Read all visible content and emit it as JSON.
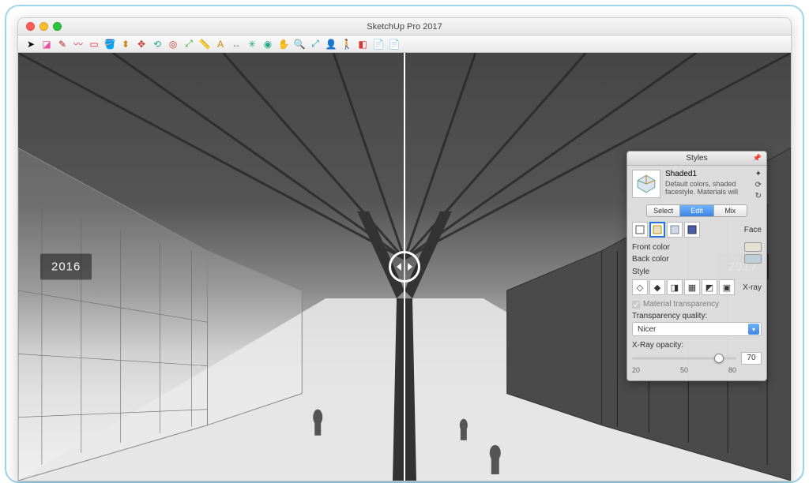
{
  "window": {
    "title": "SketchUp Pro 2017"
  },
  "toolbar": {
    "tools": [
      {
        "name": "select",
        "glyph": "➤",
        "color": "#000"
      },
      {
        "name": "eraser",
        "glyph": "◪",
        "color": "#e84fa0"
      },
      {
        "name": "line",
        "glyph": "✎",
        "color": "#b22"
      },
      {
        "name": "freehand",
        "glyph": "〰",
        "color": "#d33"
      },
      {
        "name": "rectangle",
        "glyph": "▭",
        "color": "#d33"
      },
      {
        "name": "paint",
        "glyph": "🪣",
        "color": "#c8860d"
      },
      {
        "name": "pushpull",
        "glyph": "⬍",
        "color": "#c8860d"
      },
      {
        "name": "move",
        "glyph": "✥",
        "color": "#c33"
      },
      {
        "name": "rotate",
        "glyph": "⟲",
        "color": "#2a8"
      },
      {
        "name": "offset",
        "glyph": "◎",
        "color": "#c33"
      },
      {
        "name": "scale",
        "glyph": "⤢",
        "color": "#3a3"
      },
      {
        "name": "tape",
        "glyph": "📏",
        "color": "#c8860d"
      },
      {
        "name": "text",
        "glyph": "A",
        "color": "#c8860d"
      },
      {
        "name": "dimension",
        "glyph": "↔",
        "color": "#888"
      },
      {
        "name": "axes",
        "glyph": "✳",
        "color": "#2a8"
      },
      {
        "name": "orbit",
        "glyph": "◉",
        "color": "#2a8"
      },
      {
        "name": "pan",
        "glyph": "✋",
        "color": "#c8860d"
      },
      {
        "name": "zoom",
        "glyph": "🔍",
        "color": "#2a7"
      },
      {
        "name": "zoomext",
        "glyph": "⤢",
        "color": "#29a"
      },
      {
        "name": "position",
        "glyph": "👤",
        "color": "#c33"
      },
      {
        "name": "walk",
        "glyph": "🚶",
        "color": "#c33"
      },
      {
        "name": "section",
        "glyph": "◧",
        "color": "#d33"
      },
      {
        "name": "layout1",
        "glyph": "📄",
        "color": "#d33"
      },
      {
        "name": "layout2",
        "glyph": "📄",
        "color": "#d33"
      }
    ]
  },
  "compare": {
    "left_label": "2016",
    "right_label": "2017"
  },
  "styles_panel": {
    "title": "Styles",
    "style_name": "Shaded1",
    "style_desc": "Default colors, shaded facestyle.  Materials will",
    "tabs": {
      "select": "Select",
      "edit": "Edit",
      "mix": "Mix",
      "active": "edit"
    },
    "face_label": "Face",
    "front_color_label": "Front color",
    "back_color_label": "Back color",
    "style_label": "Style",
    "xray_label": "X-ray",
    "material_transparency_label": "Material transparency",
    "transparency_quality_label": "Transparency quality:",
    "transparency_quality_value": "Nicer",
    "xray_opacity_label": "X-Ray opacity:",
    "xray_opacity_value": "70",
    "ticks": {
      "a": "20",
      "b": "50",
      "c": "80"
    },
    "slider_percent": 83
  }
}
